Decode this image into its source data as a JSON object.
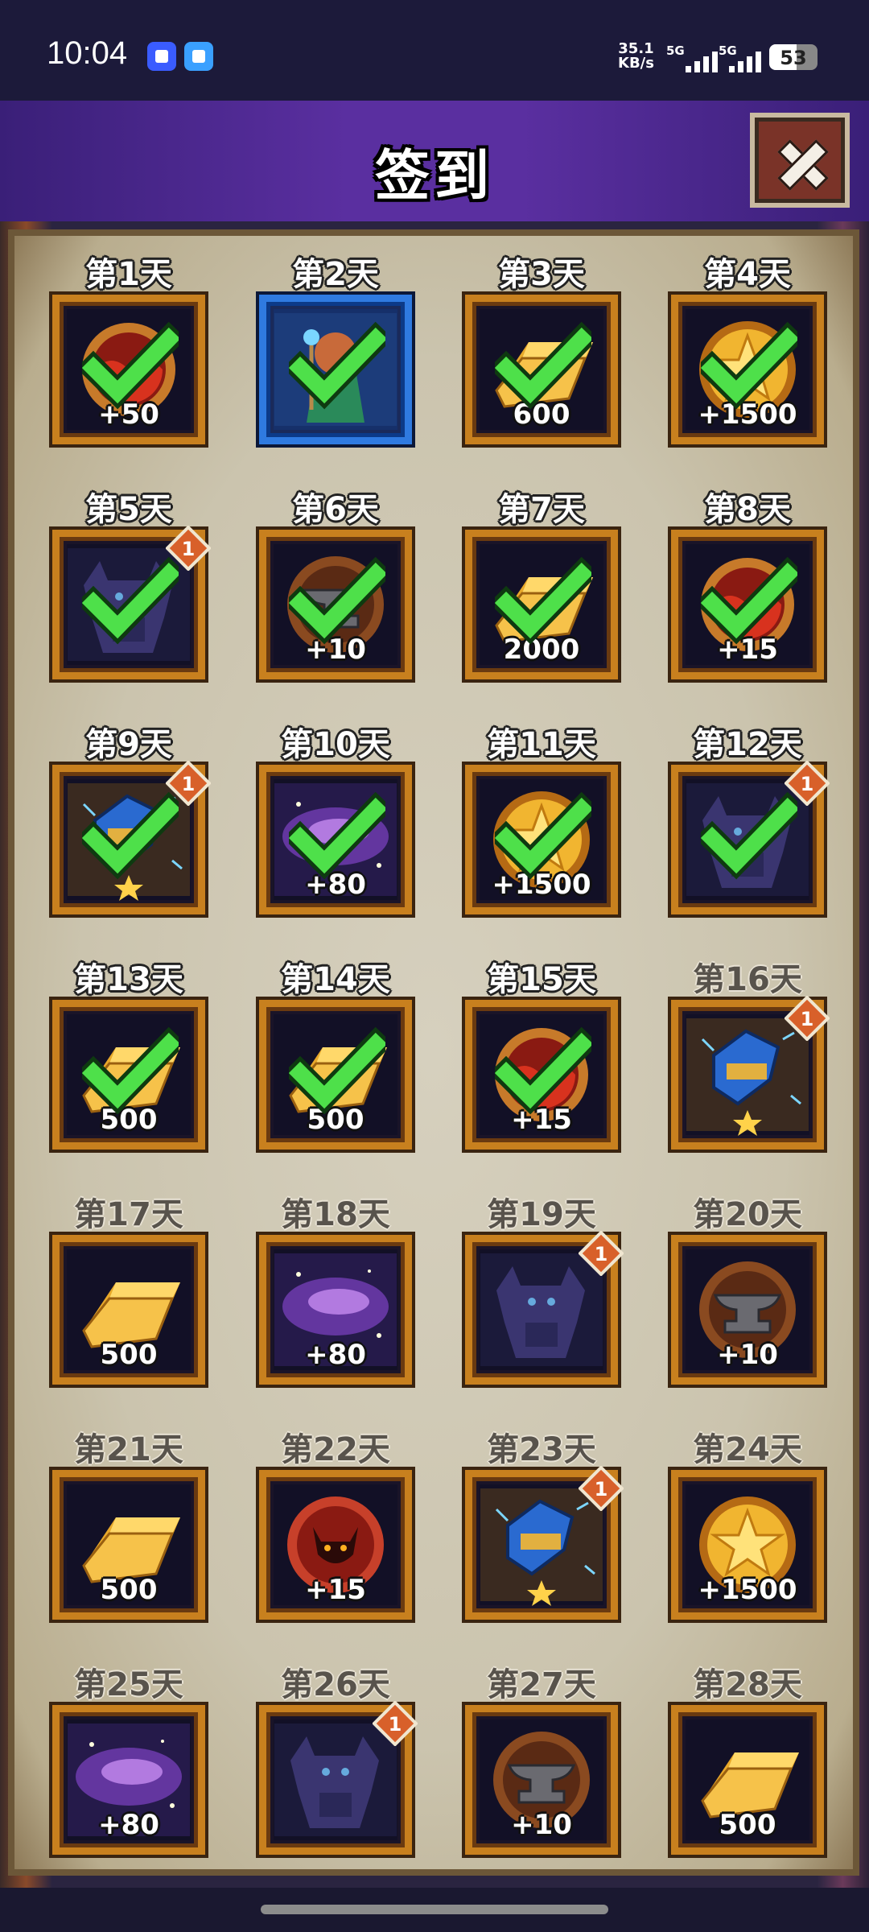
{
  "status_bar": {
    "time": "10:04",
    "net_speed_value": "35.1",
    "net_speed_unit": "KB/s",
    "signal1": "5G",
    "signal2": "5G",
    "battery": "53"
  },
  "header": {
    "title": "签到"
  },
  "days": [
    {
      "label": "第1天",
      "reward": "potion-orb",
      "amount": "+50",
      "claimed": true
    },
    {
      "label": "第2天",
      "reward": "hero-card",
      "amount": "",
      "claimed": true
    },
    {
      "label": "第3天",
      "reward": "gold-bar",
      "amount": "600",
      "claimed": true
    },
    {
      "label": "第4天",
      "reward": "star-coin",
      "amount": "+1500",
      "claimed": true
    },
    {
      "label": "第5天",
      "reward": "demon-figure",
      "amount": "",
      "claimed": true,
      "badge": "1"
    },
    {
      "label": "第6天",
      "reward": "anvil",
      "amount": "+10",
      "claimed": true
    },
    {
      "label": "第7天",
      "reward": "gold-bar",
      "amount": "2000",
      "claimed": true
    },
    {
      "label": "第8天",
      "reward": "potion-orb",
      "amount": "+15",
      "claimed": true
    },
    {
      "label": "第9天",
      "reward": "gauntlet",
      "amount": "",
      "claimed": true,
      "badge": "1"
    },
    {
      "label": "第10天",
      "reward": "nebula",
      "amount": "+80",
      "claimed": true
    },
    {
      "label": "第11天",
      "reward": "star-coin",
      "amount": "+1500",
      "claimed": true
    },
    {
      "label": "第12天",
      "reward": "demon-figure",
      "amount": "",
      "claimed": true,
      "badge": "1"
    },
    {
      "label": "第13天",
      "reward": "gold-bar",
      "amount": "500",
      "claimed": true
    },
    {
      "label": "第14天",
      "reward": "gold-bar",
      "amount": "500",
      "claimed": true
    },
    {
      "label": "第15天",
      "reward": "potion-orb",
      "amount": "+15",
      "claimed": true
    },
    {
      "label": "第16天",
      "reward": "gauntlet",
      "amount": "",
      "claimed": false,
      "badge": "1"
    },
    {
      "label": "第17天",
      "reward": "gold-bar",
      "amount": "500",
      "claimed": false
    },
    {
      "label": "第18天",
      "reward": "nebula",
      "amount": "+80",
      "claimed": false
    },
    {
      "label": "第19天",
      "reward": "demon-figure",
      "amount": "",
      "claimed": false,
      "badge": "1"
    },
    {
      "label": "第20天",
      "reward": "anvil",
      "amount": "+10",
      "claimed": false
    },
    {
      "label": "第21天",
      "reward": "gold-bar",
      "amount": "500",
      "claimed": false
    },
    {
      "label": "第22天",
      "reward": "demon-orb",
      "amount": "+15",
      "claimed": false
    },
    {
      "label": "第23天",
      "reward": "gauntlet",
      "amount": "",
      "claimed": false,
      "badge": "1"
    },
    {
      "label": "第24天",
      "reward": "star-coin",
      "amount": "+1500",
      "claimed": false
    },
    {
      "label": "第25天",
      "reward": "nebula",
      "amount": "+80",
      "claimed": false
    },
    {
      "label": "第26天",
      "reward": "demon-figure",
      "amount": "",
      "claimed": false,
      "badge": "1"
    },
    {
      "label": "第27天",
      "reward": "anvil",
      "amount": "+10",
      "claimed": false
    },
    {
      "label": "第28天",
      "reward": "gold-bar",
      "amount": "500",
      "claimed": false
    }
  ]
}
